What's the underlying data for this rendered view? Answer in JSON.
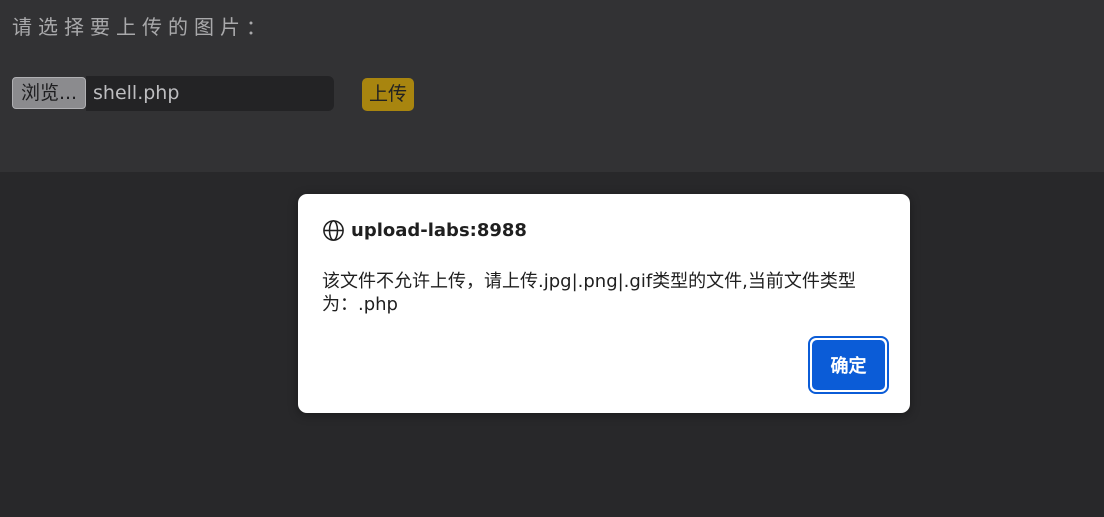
{
  "page": {
    "prompt": "请选择要上传的图片：",
    "browse_label": "浏览...",
    "file_name": "shell.php",
    "upload_label": "上传"
  },
  "dialog": {
    "icon": "globe-icon",
    "title": "upload-labs:8988",
    "message": "该文件不允许上传，请上传.jpg|.png|.gif类型的文件,当前文件类型为：.php",
    "ok_label": "确定"
  },
  "colors": {
    "page_background": "#323234",
    "overlay_background": "#28282a",
    "upload_button": "#a8850f",
    "dialog_primary": "#0b5cd7"
  }
}
